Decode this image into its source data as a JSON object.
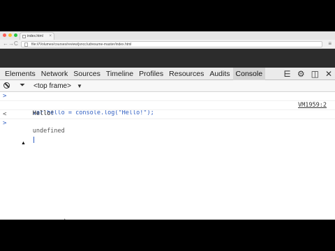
{
  "browser": {
    "tab_title": "index.html",
    "close_glyph": "×",
    "url": "file:///Volumes/courses/review/jsncc/udresume-master/index.html",
    "back_glyph": "←",
    "forward_glyph": "→",
    "reload_glyph": "C",
    "menu_glyph": "≡",
    "traffic_colors": [
      "#ff5f57",
      "#febc2e",
      "#28c840"
    ]
  },
  "devtools": {
    "tabs": [
      "Elements",
      "Network",
      "Sources",
      "Timeline",
      "Profiles",
      "Resources",
      "Audits",
      "Console"
    ],
    "active_tab": "Console",
    "right_icons": [
      "drawer-icon",
      "gear-icon",
      "dock-icon",
      "close-icon"
    ],
    "drawer_glyph": "⋿",
    "gear_glyph": "⚙",
    "dock_glyph": "◫",
    "close_glyph": "✕",
    "frame_selector": "<top frame>",
    "frame_arrow": "▼",
    "filter_glyph": "⏷"
  },
  "console": {
    "lines": [
      {
        "prompt": ">",
        "text": "var hello = console.log(\"Hello!\");",
        "kind": "command"
      },
      {
        "prompt": "",
        "text": "Hello!",
        "kind": "log",
        "source": "VM1959:2"
      },
      {
        "prompt": "<",
        "text": "undefined",
        "kind": "result"
      },
      {
        "prompt": ">",
        "text": "",
        "kind": "input"
      }
    ]
  },
  "colors": {
    "command_text": "#2f5ec2",
    "active_tab_bg": "#d5d5d5",
    "page_bg": "#2c2c2c"
  }
}
